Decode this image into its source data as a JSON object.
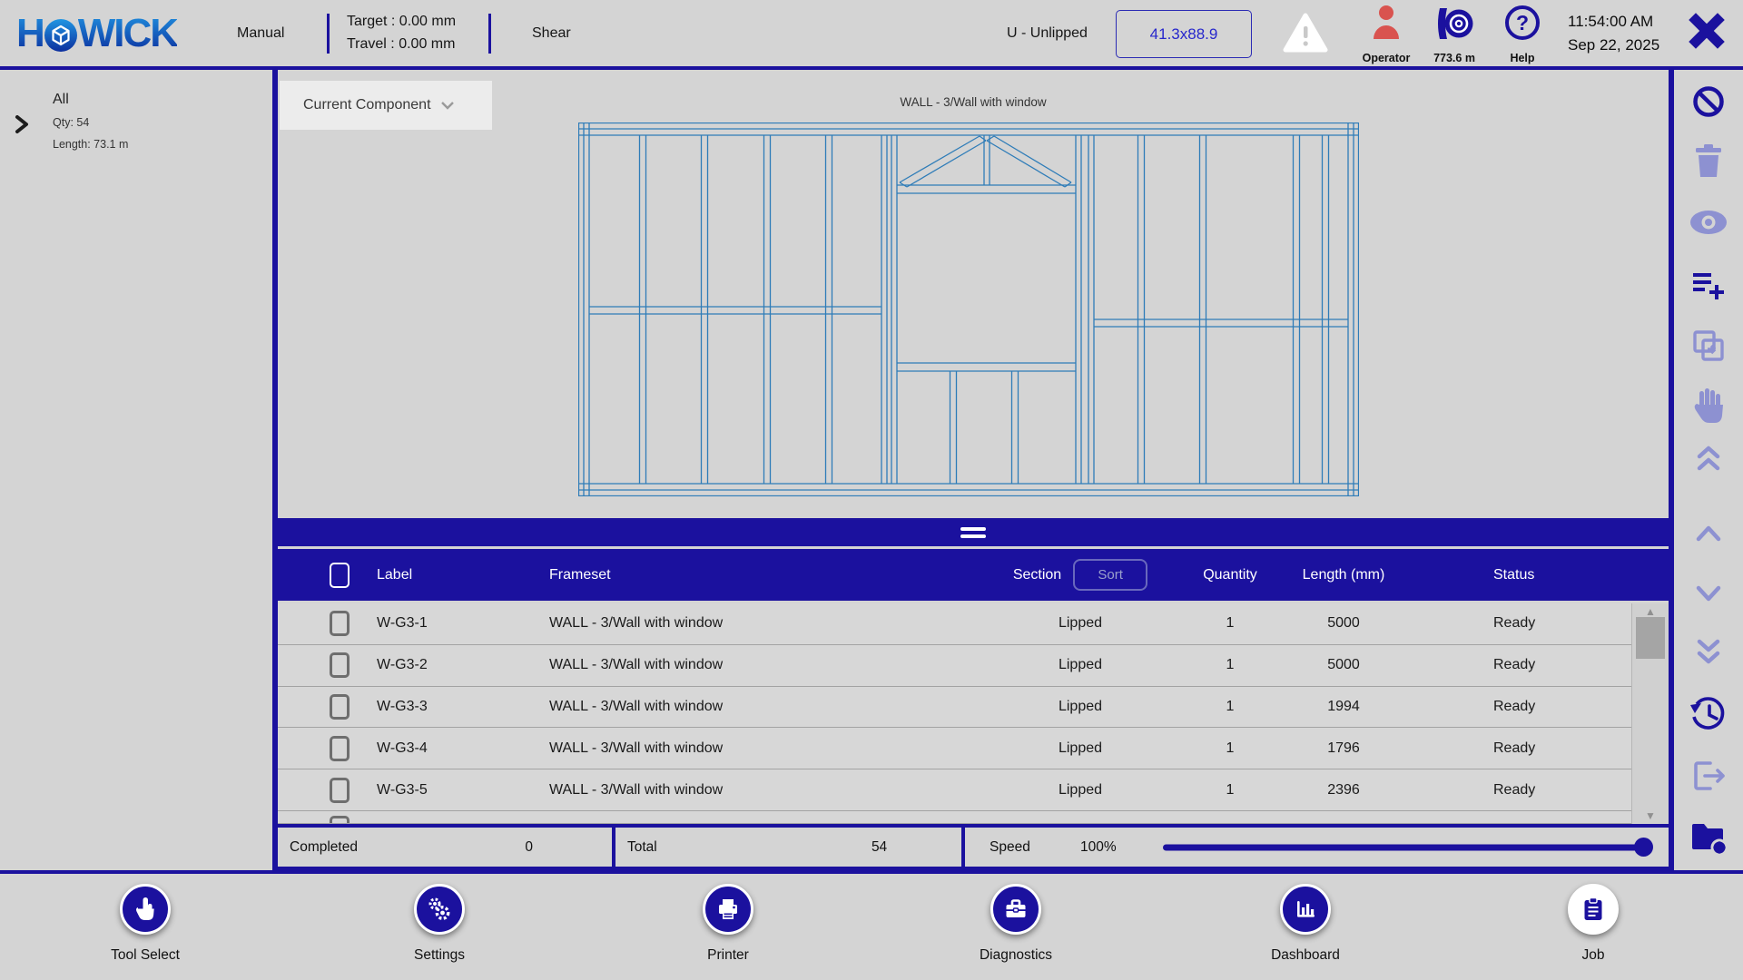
{
  "topbar": {
    "logo_left": "H",
    "logo_right": "WICK",
    "mode": "Manual",
    "target": "Target : 0.00 mm",
    "travel": "Travel : 0.00 mm",
    "tool": "Shear",
    "profile": "U - Unlipped",
    "dimension": "41.3x88.9",
    "operator_label": "Operator",
    "coil_length": "773.6 m",
    "help_label": "Help",
    "time": "11:54:00 AM",
    "date": "Sep 22, 2025"
  },
  "sidebar": {
    "title": "All",
    "qty": "Qty: 54",
    "length": "Length: 73.1 m"
  },
  "main": {
    "dropdown_label": "Current Component",
    "drawing_title": "WALL - 3/Wall with window"
  },
  "table": {
    "headers": {
      "label": "Label",
      "frameset": "Frameset",
      "section": "Section",
      "sort": "Sort",
      "quantity": "Quantity",
      "length": "Length (mm)",
      "status": "Status"
    },
    "rows": [
      {
        "label": "W-G3-1",
        "frameset": "WALL - 3/Wall with window",
        "section": "Lipped",
        "quantity": "1",
        "length": "5000",
        "status": "Ready"
      },
      {
        "label": "W-G3-2",
        "frameset": "WALL - 3/Wall with window",
        "section": "Lipped",
        "quantity": "1",
        "length": "5000",
        "status": "Ready"
      },
      {
        "label": "W-G3-3",
        "frameset": "WALL - 3/Wall with window",
        "section": "Lipped",
        "quantity": "1",
        "length": "1994",
        "status": "Ready"
      },
      {
        "label": "W-G3-4",
        "frameset": "WALL - 3/Wall with window",
        "section": "Lipped",
        "quantity": "1",
        "length": "1796",
        "status": "Ready"
      },
      {
        "label": "W-G3-5",
        "frameset": "WALL - 3/Wall with window",
        "section": "Lipped",
        "quantity": "1",
        "length": "2396",
        "status": "Ready"
      }
    ]
  },
  "stats": {
    "completed_label": "Completed",
    "completed_value": "0",
    "total_label": "Total",
    "total_value": "54",
    "speed_label": "Speed",
    "speed_value": "100%"
  },
  "nav": {
    "items": [
      {
        "label": "Tool Select",
        "icon": "pointer-icon"
      },
      {
        "label": "Settings",
        "icon": "gears-icon"
      },
      {
        "label": "Printer",
        "icon": "printer-icon"
      },
      {
        "label": "Diagnostics",
        "icon": "toolbox-icon"
      },
      {
        "label": "Dashboard",
        "icon": "bar-chart-icon"
      },
      {
        "label": "Job",
        "icon": "clipboard-icon",
        "active": true
      }
    ]
  },
  "right_toolbar": {
    "icons": [
      "block-icon",
      "delete-icon",
      "view-icon",
      "add-to-list-icon",
      "duplicate-icon",
      "pan-hand-icon",
      "double-chevron-up-icon",
      "chevron-up-icon",
      "chevron-down-icon",
      "double-chevron-down-icon",
      "history-icon",
      "export-icon",
      "add-folder-icon"
    ]
  },
  "colors": {
    "navy": "#1b119e",
    "faded_icon": "#8d91d1",
    "operator_red": "#d9534f",
    "dim_text_blue": "#2727cc",
    "frame_stroke": "#2e7cb8",
    "background": "#d4d4d4"
  }
}
